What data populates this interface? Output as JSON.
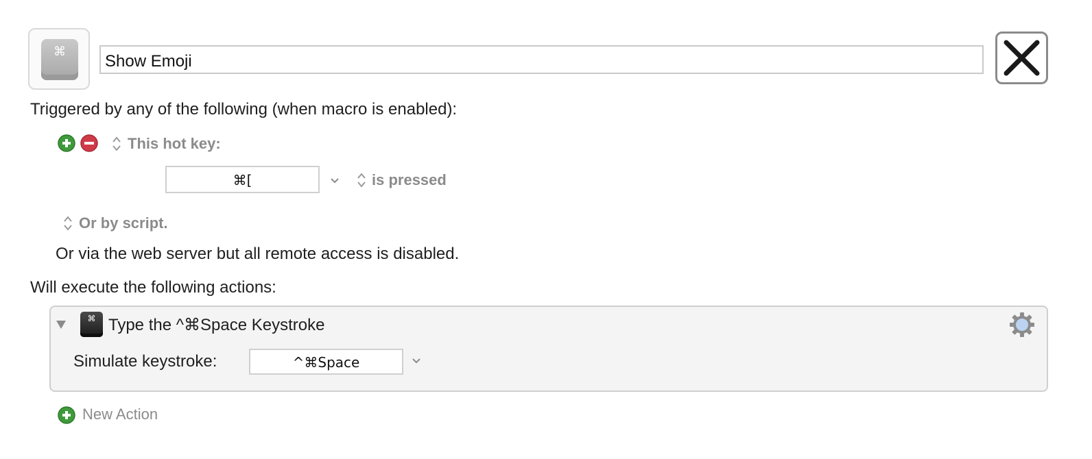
{
  "macro": {
    "icon_glyph": "⌘",
    "name": "Show Emoji",
    "close_icon": "close-x-icon"
  },
  "triggers": {
    "heading": "Triggered by any of the following (when macro is enabled):",
    "hot_key_label": "This hot key:",
    "hot_key_value": "⌘[",
    "hot_key_condition": "is pressed",
    "script_label": "Or by script.",
    "web_server_note": "Or via the web server but all remote access is disabled."
  },
  "actions": {
    "heading": "Will execute the following actions:",
    "items": [
      {
        "icon_glyph": "⌘",
        "title": "Type the ^⌘Space Keystroke",
        "field_label": "Simulate keystroke:",
        "field_value": "^⌘Space"
      }
    ],
    "new_action_label": "New Action"
  },
  "colors": {
    "add_green": "#3f9a3b",
    "remove_red": "#cf3b48",
    "muted_gray": "#8b8b8b",
    "border_gray": "#cfcfcf"
  }
}
